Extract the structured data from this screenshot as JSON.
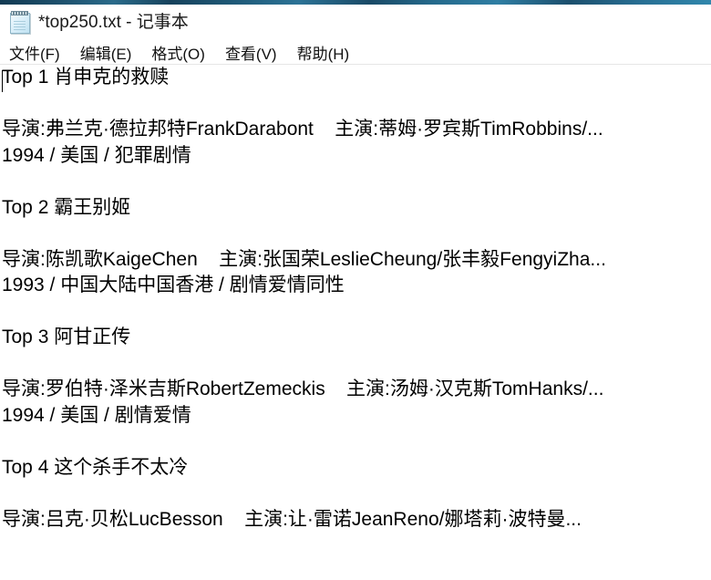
{
  "window": {
    "title": "*top250.txt - 记事本",
    "icon": "notepad-icon"
  },
  "menubar": {
    "items": [
      {
        "label": "文件(F)",
        "name": "menu-file"
      },
      {
        "label": "编辑(E)",
        "name": "menu-edit"
      },
      {
        "label": "格式(O)",
        "name": "menu-format"
      },
      {
        "label": "查看(V)",
        "name": "menu-view"
      },
      {
        "label": "帮助(H)",
        "name": "menu-help"
      }
    ]
  },
  "document": {
    "lines": [
      "Top 1 肖申克的救赎",
      "",
      "导演:弗兰克·德拉邦特FrankDarabont    主演:蒂姆·罗宾斯TimRobbins/...",
      "1994 / 美国 / 犯罪剧情",
      "",
      "Top 2 霸王别姬",
      "",
      "导演:陈凯歌KaigeChen    主演:张国荣LeslieCheung/张丰毅FengyiZha...",
      "1993 / 中国大陆中国香港 / 剧情爱情同性",
      "",
      "Top 3 阿甘正传",
      "",
      "导演:罗伯特·泽米吉斯RobertZemeckis    主演:汤姆·汉克斯TomHanks/...",
      "1994 / 美国 / 剧情爱情",
      "",
      "Top 4 这个杀手不太冷",
      "",
      "导演:吕克·贝松LucBesson    主演:让·雷诺JeanReno/娜塔莉·波特曼..."
    ]
  },
  "colors": {
    "top_strip_accent": "#1d4f6b",
    "text": "#000000",
    "background": "#ffffff",
    "separator": "#e6e6e6"
  }
}
